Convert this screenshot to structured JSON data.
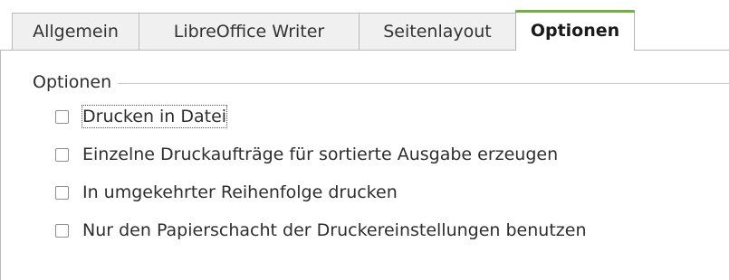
{
  "tabs": [
    {
      "label": "Allgemein"
    },
    {
      "label": "LibreOffice Writer"
    },
    {
      "label": "Seitenlayout"
    },
    {
      "label": "Optionen",
      "active": true
    }
  ],
  "group": {
    "title": "Optionen",
    "options": [
      {
        "label": "Drucken in Datei",
        "checked": false,
        "focused": true
      },
      {
        "label": "Einzelne Druckaufträge für sortierte Ausgabe erzeugen",
        "checked": false
      },
      {
        "label": "In umgekehrter Reihenfolge drucken",
        "checked": false
      },
      {
        "label": "Nur den Papierschacht der Druckereinstellungen benutzen",
        "checked": false
      }
    ]
  },
  "colors": {
    "active_tab_accent": "#6fb23b"
  }
}
